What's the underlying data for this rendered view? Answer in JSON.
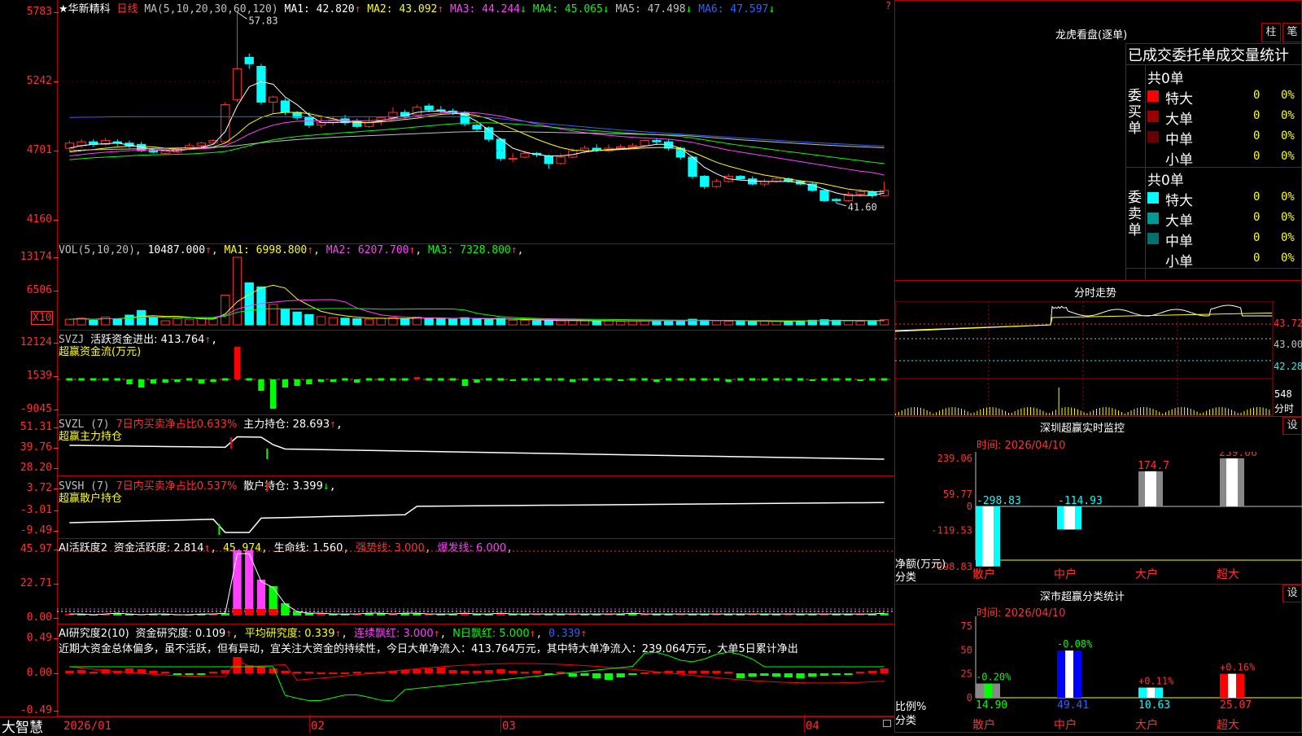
{
  "chart_data": [
    {
      "type": "candlestick",
      "title": "华新精科 日线",
      "ylim": [
        4160,
        5783
      ],
      "ticks": [
        "5783",
        "5242",
        "4701",
        "4160"
      ],
      "annotations": [
        "57.83",
        "41.60"
      ],
      "legend": {
        "name": "★华新精科",
        "period": "日线",
        "ma": "MA(5,10,20,30,60,120)",
        "items": [
          {
            "label": "MA1: 42.820",
            "arrow": "↑",
            "color": "#ffffff"
          },
          {
            "label": "MA2: 43.092",
            "arrow": "↑",
            "color": "#ffff00"
          },
          {
            "label": "MA3: 44.244",
            "arrow": "↓",
            "color": "#ff40ff"
          },
          {
            "label": "MA4: 45.065",
            "arrow": "↓",
            "color": "#00ff00"
          },
          {
            "label": "MA5: 47.498",
            "arrow": "↓",
            "color": "#c0c0c0"
          },
          {
            "label": "MA6: 47.597",
            "arrow": "↓",
            "color": "#3060ff"
          }
        ]
      },
      "candles": [
        [
          4720,
          4760,
          4700,
          4780
        ],
        [
          4740,
          4770,
          4720,
          4790
        ],
        [
          4770,
          4750,
          4730,
          4790
        ],
        [
          4750,
          4780,
          4740,
          4800
        ],
        [
          4770,
          4760,
          4740,
          4790
        ],
        [
          4760,
          4740,
          4720,
          4780
        ],
        [
          4750,
          4700,
          4690,
          4770
        ],
        [
          4700,
          4690,
          4680,
          4720
        ],
        [
          4680,
          4700,
          4670,
          4720
        ],
        [
          4690,
          4720,
          4680,
          4730
        ],
        [
          4720,
          4740,
          4710,
          4760
        ],
        [
          4740,
          4760,
          4720,
          4770
        ],
        [
          4760,
          4780,
          4750,
          4790
        ],
        [
          4770,
          5060,
          4760,
          5080
        ],
        [
          5100,
          5340,
          5080,
          5783
        ],
        [
          5430,
          5380,
          5340,
          5460
        ],
        [
          5360,
          5080,
          5060,
          5380
        ],
        [
          5080,
          5120,
          4990,
          5130
        ],
        [
          5090,
          5000,
          4980,
          5110
        ],
        [
          5000,
          4960,
          4940,
          5010
        ],
        [
          4960,
          4900,
          4880,
          5000
        ],
        [
          4900,
          4920,
          4880,
          4960
        ],
        [
          4920,
          4940,
          4900,
          4970
        ],
        [
          4950,
          4920,
          4900,
          4980
        ],
        [
          4930,
          4890,
          4880,
          4950
        ],
        [
          4890,
          4920,
          4880,
          4960
        ],
        [
          4930,
          4960,
          4900,
          4970
        ],
        [
          4960,
          5000,
          4950,
          5040
        ],
        [
          5000,
          4970,
          4950,
          5020
        ],
        [
          4980,
          5040,
          4970,
          5060
        ],
        [
          5050,
          5020,
          5000,
          5070
        ],
        [
          5020,
          5010,
          4990,
          5050
        ],
        [
          5010,
          5000,
          4980,
          5030
        ],
        [
          5000,
          4910,
          4890,
          5010
        ],
        [
          4900,
          4870,
          4850,
          4910
        ],
        [
          4880,
          4790,
          4770,
          4890
        ],
        [
          4790,
          4640,
          4620,
          4800
        ],
        [
          4640,
          4640,
          4610,
          4680
        ],
        [
          4650,
          4680,
          4640,
          4700
        ],
        [
          4680,
          4670,
          4650,
          4690
        ],
        [
          4660,
          4600,
          4560,
          4670
        ],
        [
          4600,
          4650,
          4590,
          4680
        ],
        [
          4650,
          4700,
          4640,
          4720
        ],
        [
          4700,
          4720,
          4680,
          4740
        ],
        [
          4720,
          4700,
          4690,
          4750
        ],
        [
          4700,
          4720,
          4690,
          4750
        ],
        [
          4720,
          4730,
          4710,
          4750
        ],
        [
          4730,
          4740,
          4720,
          4760
        ],
        [
          4740,
          4780,
          4730,
          4790
        ],
        [
          4780,
          4770,
          4750,
          4800
        ],
        [
          4770,
          4720,
          4700,
          4790
        ],
        [
          4720,
          4650,
          4630,
          4730
        ],
        [
          4650,
          4500,
          4480,
          4660
        ],
        [
          4500,
          4420,
          4400,
          4510
        ],
        [
          4420,
          4460,
          4410,
          4480
        ],
        [
          4460,
          4500,
          4450,
          4520
        ],
        [
          4500,
          4480,
          4470,
          4510
        ],
        [
          4480,
          4440,
          4430,
          4500
        ],
        [
          4440,
          4460,
          4420,
          4480
        ],
        [
          4460,
          4480,
          4450,
          4490
        ],
        [
          4480,
          4460,
          4450,
          4490
        ],
        [
          4460,
          4440,
          4430,
          4470
        ],
        [
          4440,
          4390,
          4380,
          4450
        ],
        [
          4390,
          4310,
          4300,
          4400
        ],
        [
          4320,
          4310,
          4290,
          4330
        ],
        [
          4310,
          4360,
          4300,
          4380
        ],
        [
          4360,
          4380,
          4340,
          4400
        ],
        [
          4380,
          4350,
          4330,
          4390
        ],
        [
          4350,
          4390,
          4340,
          4460
        ]
      ],
      "ma_lines": {
        "ma1": [
          4720,
          4740,
          4750,
          4755,
          4760,
          4745,
          4728,
          4710,
          4700,
          4700,
          4712,
          4728,
          4750,
          4850,
          5050,
          5200,
          5240,
          5220,
          5120,
          5060,
          4980,
          4920,
          4920,
          4925,
          4925,
          4920,
          4935,
          4955,
          4975,
          5000,
          5010,
          5010,
          5000,
          4980,
          4930,
          4860,
          4790,
          4720,
          4690,
          4670,
          4660,
          4660,
          4670,
          4690,
          4700,
          4710,
          4715,
          4722,
          4735,
          4750,
          4750,
          4720,
          4650,
          4570,
          4520,
          4480,
          4470,
          4465,
          4460,
          4460,
          4460,
          4450,
          4430,
          4400,
          4370,
          4350,
          4350,
          4350,
          4370
        ],
        "ma2": [
          4690,
          4700,
          4710,
          4720,
          4730,
          4735,
          4735,
          4730,
          4720,
          4712,
          4712,
          4718,
          4730,
          4760,
          4830,
          4910,
          4960,
          4990,
          5000,
          5000,
          4990,
          4970,
          4950,
          4930,
          4920,
          4920,
          4925,
          4935,
          4945,
          4955,
          4970,
          4985,
          4990,
          4990,
          4975,
          4950,
          4910,
          4870,
          4830,
          4790,
          4755,
          4725,
          4705,
          4700,
          4700,
          4705,
          4710,
          4715,
          4722,
          4725,
          4725,
          4715,
          4690,
          4650,
          4610,
          4580,
          4555,
          4530,
          4510,
          4495,
          4480,
          4465,
          4455,
          4440,
          4420,
          4400,
          4390,
          4380,
          4380
        ],
        "ma3": [
          4660,
          4670,
          4680,
          4688,
          4695,
          4700,
          4705,
          4708,
          4708,
          4708,
          4710,
          4715,
          4722,
          4740,
          4780,
          4830,
          4870,
          4900,
          4920,
          4930,
          4935,
          4935,
          4935,
          4935,
          4935,
          4935,
          4940,
          4948,
          4958,
          4970,
          4985,
          4995,
          5000,
          5000,
          4995,
          4985,
          4970,
          4950,
          4930,
          4910,
          4890,
          4870,
          4855,
          4842,
          4830,
          4820,
          4812,
          4805,
          4800,
          4795,
          4790,
          4780,
          4765,
          4745,
          4725,
          4705,
          4690,
          4675,
          4660,
          4645,
          4630,
          4615,
          4600,
          4585,
          4570,
          4555,
          4540,
          4530,
          4510
        ],
        "ma4": [
          4630,
          4638,
          4645,
          4650,
          4655,
          4660,
          4665,
          4668,
          4670,
          4672,
          4675,
          4680,
          4686,
          4695,
          4715,
          4740,
          4765,
          4785,
          4800,
          4812,
          4820,
          4828,
          4835,
          4842,
          4848,
          4855,
          4862,
          4870,
          4878,
          4886,
          4895,
          4903,
          4910,
          4915,
          4918,
          4918,
          4915,
          4910,
          4903,
          4895,
          4886,
          4878,
          4870,
          4862,
          4855,
          4848,
          4842,
          4836,
          4830,
          4825,
          4820,
          4812,
          4800,
          4785,
          4770,
          4755,
          4742,
          4730,
          4718,
          4705,
          4693,
          4682,
          4670,
          4658,
          4646,
          4634,
          4622,
          4610,
          4600
        ],
        "ma5": [
          4700,
          4705,
          4708,
          4710,
          4712,
          4714,
          4716,
          4718,
          4720,
          4722,
          4724,
          4726,
          4728,
          4732,
          4740,
          4752,
          4762,
          4772,
          4780,
          4788,
          4794,
          4800,
          4805,
          4810,
          4814,
          4818,
          4822,
          4826,
          4830,
          4834,
          4838,
          4842,
          4846,
          4848,
          4850,
          4851,
          4851,
          4850,
          4848,
          4846,
          4844,
          4842,
          4840,
          4838,
          4836,
          4834,
          4832,
          4830,
          4828,
          4826,
          4823,
          4820,
          4815,
          4808,
          4800,
          4793,
          4786,
          4780,
          4774,
          4768,
          4762,
          4756,
          4750,
          4745,
          4740,
          4735,
          4731,
          4727,
          4723
        ],
        "ma6": [
          4960,
          4962,
          4963,
          4964,
          4965,
          4966,
          4966,
          4966,
          4966,
          4966,
          4966,
          4966,
          4966,
          4966,
          4966,
          4966,
          4966,
          4966,
          4966,
          4966,
          4966,
          4966,
          4966,
          4966,
          4966,
          4966,
          4966,
          4966,
          4966,
          4966,
          4966,
          4966,
          4966,
          4966,
          4966,
          4960,
          4950,
          4940,
          4930,
          4920,
          4910,
          4902,
          4894,
          4886,
          4878,
          4870,
          4862,
          4855,
          4848,
          4842,
          4836,
          4830,
          4824,
          4818,
          4812,
          4806,
          4800,
          4794,
          4788,
          4782,
          4776,
          4770,
          4765,
          4760,
          4755,
          4750,
          4745,
          4740,
          4736
        ]
      }
    },
    {
      "type": "bar",
      "title": "VOL(5,10,20)",
      "ticks": [
        "13174",
        "6506",
        "X10"
      ],
      "legend": [
        {
          "label": "VOL(5,10,20)",
          "color": "#c0c0c0"
        },
        {
          "label": "10487.000",
          "arrow": "↑",
          "color": "#ffffff"
        },
        {
          "label": "MA1: 6998.800",
          "arrow": "↑",
          "color": "#ffff00"
        },
        {
          "label": "MA2: 6207.700",
          "arrow": "↑",
          "color": "#ff40ff"
        },
        {
          "label": "MA3: 7328.800",
          "arrow": "↑",
          "color": "#00ff00"
        }
      ],
      "ylim": [
        0,
        13174
      ],
      "values": [
        1100,
        1300,
        900,
        1500,
        1200,
        1900,
        2800,
        1500,
        800,
        1200,
        1100,
        1300,
        1200,
        5800,
        13174,
        8200,
        7400,
        4000,
        3100,
        2500,
        2000,
        1600,
        1400,
        1300,
        1200,
        1100,
        1300,
        1400,
        1200,
        1500,
        1300,
        1200,
        1100,
        1400,
        1100,
        1000,
        1300,
        900,
        900,
        800,
        800,
        800,
        900,
        800,
        700,
        800,
        700,
        800,
        800,
        900,
        800,
        800,
        1100,
        900,
        800,
        700,
        700,
        700,
        800,
        700,
        700,
        800,
        900,
        1000,
        900,
        800,
        700,
        800,
        1000
      ]
    }
  ],
  "indicators": {
    "svzj": {
      "name": "SVZJ",
      "label": "活跃资金进出: 413.764",
      "arrow": "↑",
      "sub": "超赢资金流(万元)",
      "ticks": [
        "12124",
        "1539",
        "-9045"
      ]
    },
    "svzl": {
      "name": "SVZL (7)",
      "label1": "7日内买卖净占比0.633%",
      "label2": "主力持仓: 28.693",
      "arrow": "↑",
      "sub": "超赢主力持仓",
      "ticks": [
        "51.31",
        "39.76",
        "28.20"
      ]
    },
    "svsh": {
      "name": "SVSH (7)",
      "label1": "7日内买卖净占比0.537%",
      "label2": "散户持仓: 3.399",
      "arrow": "↓",
      "sub": "超赢散户持仓",
      "ticks": [
        "3.72",
        "-3.01",
        "-9.49"
      ]
    },
    "ai_active": {
      "name": "AI活跃度2",
      "label1": "资金活跃度: 2.814",
      "v2": "45.974",
      "v3": "生命线: 1.560",
      "v4": "强势线: 3.000",
      "v5": "爆发线: 6.000",
      "ticks": [
        "45.97",
        "22.71",
        "0.00"
      ]
    },
    "ai_research": {
      "name": "AI研究度2(10)",
      "label1": "资金研究度: 0.109",
      "label2": "平均研究度: 0.339",
      "label3": "连续飘红: 3.000",
      "label4": "N日飘红: 5.000",
      "label5": "0.339",
      "text": "近期大资金总体偏多，虽不活跃，但有异动，宜关注大资金的持续性，今日大单净流入：413.764万元，其中特大单净流入：239.064万元，大单5日累计净出",
      "ticks": [
        "0.49",
        "0.00",
        "-0.49"
      ]
    }
  },
  "xaxis": {
    "labels": [
      "2026/01",
      "02",
      "03",
      "04"
    ],
    "brand": "大智慧"
  },
  "right": {
    "lhk": {
      "title": "龙虎看盘(逐单)",
      "btn1": "柱",
      "btn2": "笔",
      "heading": "已成交委托单成交量统计",
      "buy": {
        "side": "委买单",
        "total": "共0单",
        "rows": [
          {
            "k": "特大",
            "v": "0",
            "p": "0%",
            "c": "#ff0000"
          },
          {
            "k": "大单",
            "v": "0",
            "p": "0%",
            "c": "#990000"
          },
          {
            "k": "中单",
            "v": "0",
            "p": "0%",
            "c": "#660000"
          },
          {
            "k": "小单",
            "v": "0",
            "p": "0%",
            "c": ""
          }
        ]
      },
      "sell": {
        "side": "委卖单",
        "total": "共0单",
        "rows": [
          {
            "k": "特大",
            "v": "0",
            "p": "0%",
            "c": "#00ffff"
          },
          {
            "k": "大单",
            "v": "0",
            "p": "0%",
            "c": "#009999"
          },
          {
            "k": "中单",
            "v": "0",
            "p": "0%",
            "c": "#007070"
          },
          {
            "k": "小单",
            "v": "0",
            "p": "0%",
            "c": ""
          }
        ]
      }
    },
    "intraday": {
      "title": "分时走势",
      "prices": [
        "43.72",
        "43.00",
        "42.28"
      ],
      "vol": "548",
      "vol_unit": "分时"
    },
    "monitor": {
      "title": "深圳超赢实时监控",
      "btn": "设",
      "time": "时间: 2026/04/10",
      "ylabel": "净额(万元)",
      "xlabel": "分类",
      "ticks": [
        "239.06",
        "59.77",
        "0",
        "-119.53",
        "-298.83"
      ],
      "bars": [
        {
          "cat": "散户",
          "val": -298.83,
          "lab": "-298.83"
        },
        {
          "cat": "中户",
          "val": -114.93,
          "lab": "-114.93"
        },
        {
          "cat": "大户",
          "val": 174.7,
          "lab": "174.7"
        },
        {
          "cat": "超大",
          "val": 239.06,
          "lab": "239.06"
        }
      ]
    },
    "classify": {
      "title": "深市超赢分类统计",
      "btn": "设",
      "time": "时间: 2026/04/10",
      "ylabel": "比例%",
      "xlabel": "分类",
      "ticks": [
        "75",
        "50",
        "25",
        "0"
      ],
      "bars": [
        {
          "cat": "散户",
          "val": 14.9,
          "chg": "-0.20%"
        },
        {
          "cat": "中户",
          "val": 49.41,
          "chg": "-0.08%"
        },
        {
          "cat": "大户",
          "val": 10.63,
          "chg": "+0.11%"
        },
        {
          "cat": "超大",
          "val": 25.07,
          "chg": "+0.16%"
        }
      ]
    }
  }
}
